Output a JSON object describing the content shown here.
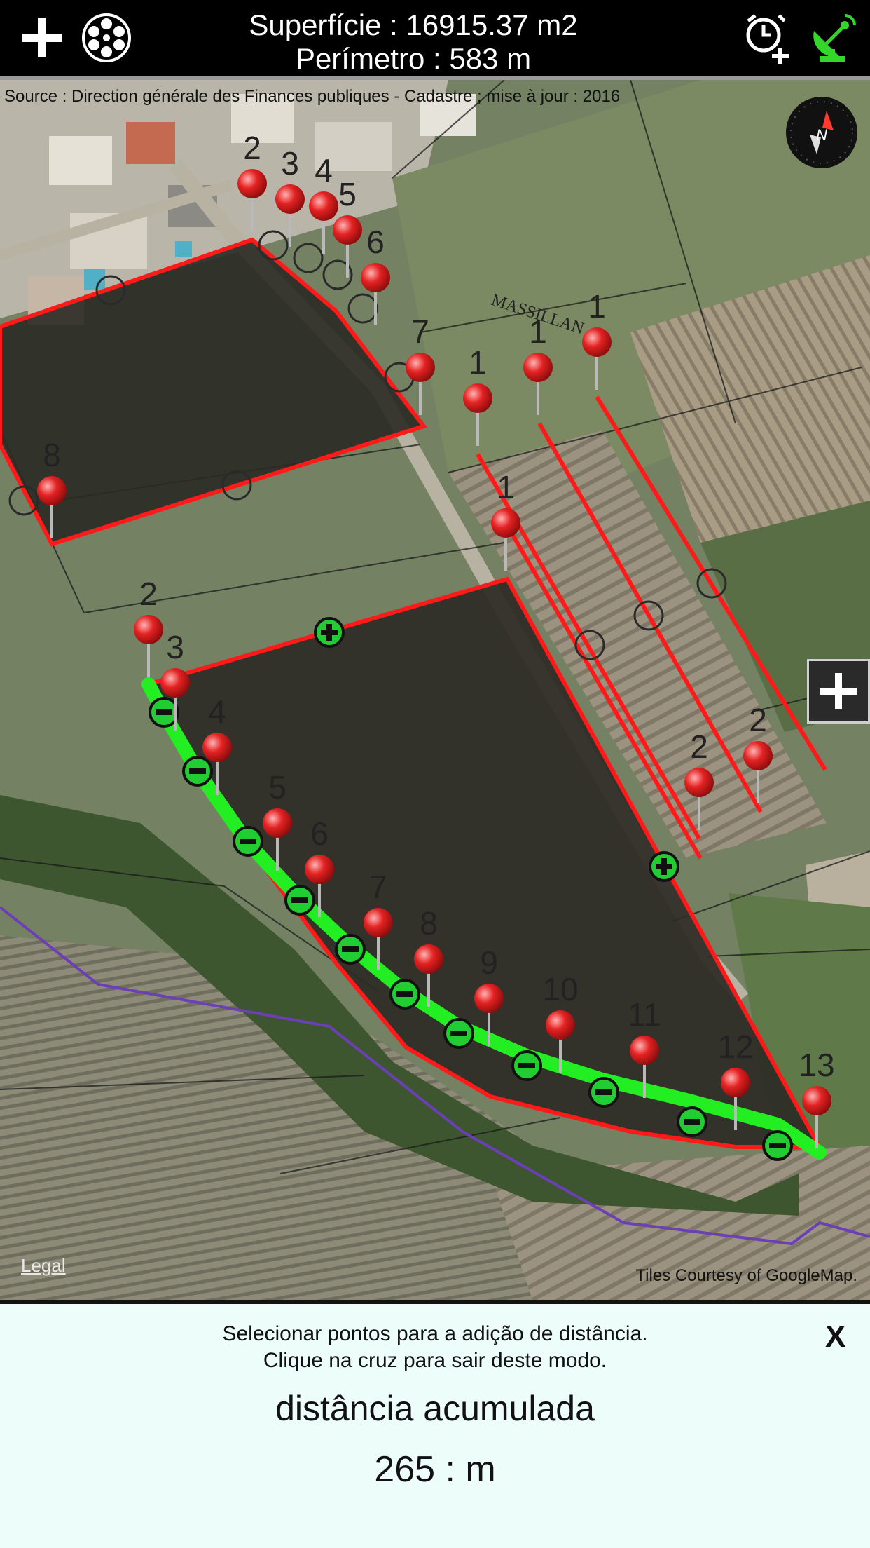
{
  "header": {
    "area_text": "Superfície : 16915.37 m2",
    "perimeter_text": "Perímetro : 583 m",
    "add_icon": "plus-icon",
    "layers_icon": "film-reel-icon",
    "alarm_icon": "alarm-add-icon",
    "gps_icon": "satellite-dish-icon"
  },
  "map": {
    "attribution": "Source : Direction générale des Finances publiques - Cadastre ; mise à jour : 2016",
    "place_name": "MASSILLAN",
    "legal_link": "Legal",
    "tiles_credit": "Tiles Courtesy of GoogleMap.",
    "compass_label": "N",
    "zoom_in_icon": "plus-icon",
    "pin_labels": [
      "2",
      "3",
      "4",
      "5",
      "6",
      "7",
      "8",
      "1",
      "1",
      "1",
      "1",
      "2",
      "3",
      "4",
      "5",
      "6",
      "7",
      "8",
      "9",
      "10",
      "11",
      "12",
      "13",
      "2",
      "2"
    ]
  },
  "colors": {
    "boundary": "#ff1a1a",
    "measure_path": "#22ee22",
    "commune_line": "#6b3fb5",
    "panel_bg": "#ecfdfa"
  },
  "panel": {
    "instruction_line1": "Selecionar pontos para a adição de distância.",
    "instruction_line2": "Clique na cruz para sair deste modo.",
    "close_label": "X",
    "distance_label": "distância acumulada",
    "distance_value": "265 : m"
  }
}
